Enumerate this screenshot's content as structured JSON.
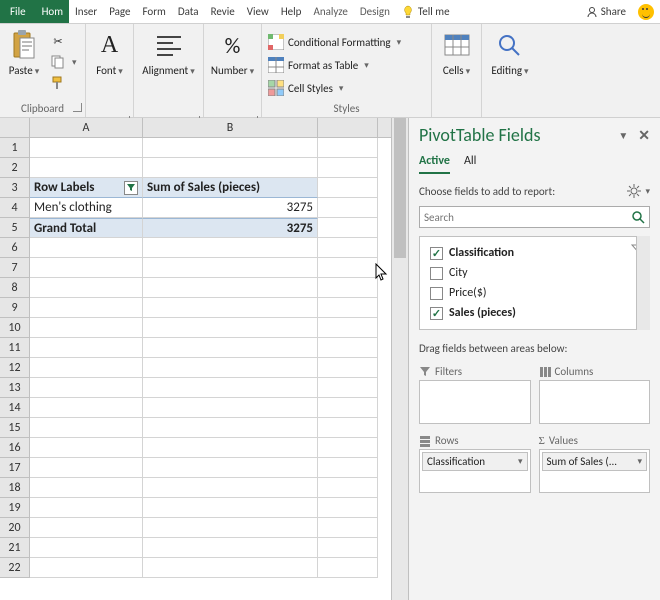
{
  "tabs": {
    "file": "File",
    "home": "Hom",
    "insert": "Inser",
    "page": "Page",
    "formulas": "Form",
    "data": "Data",
    "review": "Revie",
    "view": "View",
    "help": "Help",
    "analyze": "Analyze",
    "design": "Design",
    "tellme": "Tell me",
    "share": "Share"
  },
  "ribbon": {
    "clipboard_label": "Clipboard",
    "paste": "Paste",
    "font_label": "Font",
    "alignment_label": "Alignment",
    "number_label": "Number",
    "cond_fmt": "Conditional Formatting",
    "fmt_table": "Format as Table",
    "cell_styles": "Cell Styles",
    "styles_label": "Styles",
    "cells_label": "Cells",
    "editing_label": "Editing"
  },
  "sheet": {
    "cols": {
      "A": "A",
      "B": "B"
    },
    "rows": [
      "1",
      "2",
      "3",
      "4",
      "5",
      "6",
      "7",
      "8",
      "9",
      "10",
      "11",
      "12",
      "13",
      "14",
      "15",
      "16",
      "17",
      "18",
      "19",
      "20",
      "21",
      "22"
    ],
    "pivot": {
      "row_labels": "Row Labels",
      "sum_label": "Sum of Sales (pieces)",
      "data_row_label": "Men's clothing",
      "data_row_value": "3275",
      "total_label": "Grand Total",
      "total_value": "3275"
    }
  },
  "taskpane": {
    "title": "PivotTable Fields",
    "tab_active": "Active",
    "tab_all": "All",
    "choose": "Choose fields to add to report:",
    "search_placeholder": "Search",
    "fields": {
      "classification": "Classification",
      "city": "City",
      "price": "Price($)",
      "sales": "Sales (pieces)"
    },
    "drag_label": "Drag fields between areas below:",
    "areas": {
      "filters": "Filters",
      "columns": "Columns",
      "rows": "Rows",
      "values": "Values",
      "rows_item": "Classification",
      "values_item": "Sum of Sales (..."
    }
  }
}
